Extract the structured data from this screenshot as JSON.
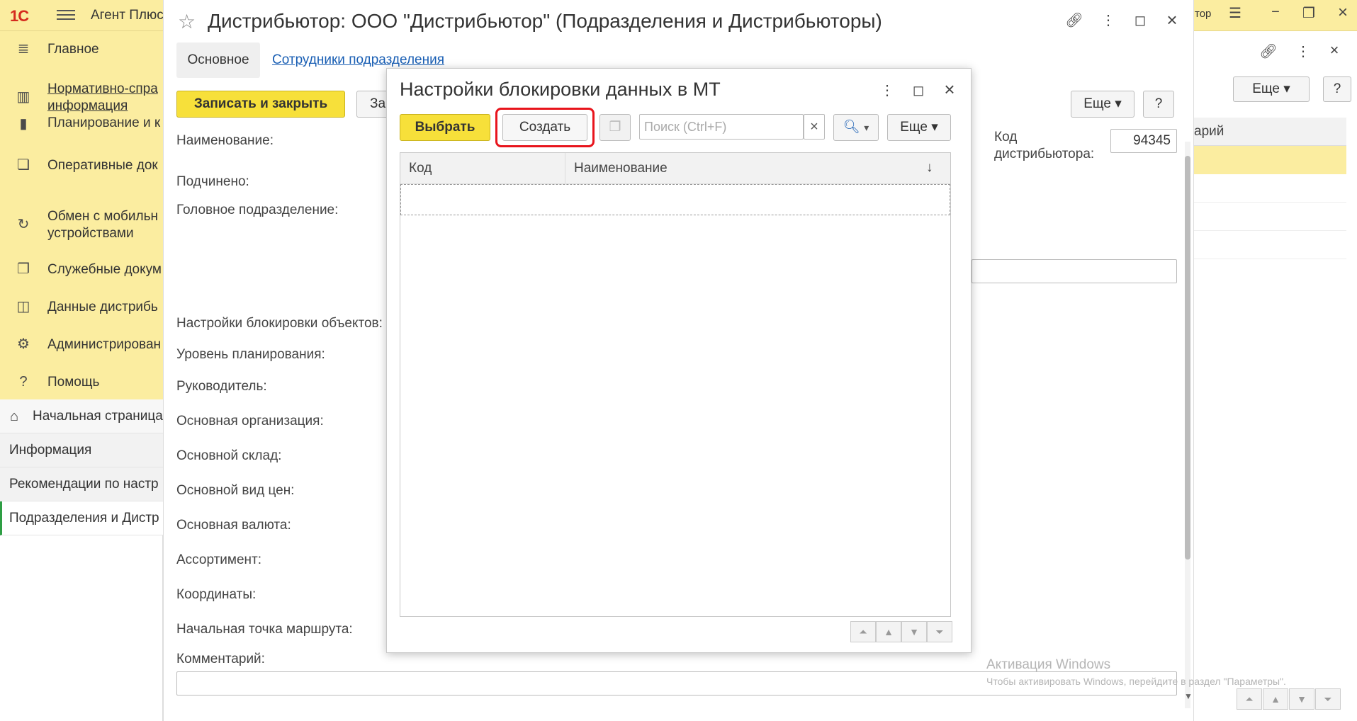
{
  "app": {
    "logo": "1С",
    "title": "Агент Плюс",
    "right_title_fragment": "тор"
  },
  "sidebar": {
    "items": [
      {
        "label": "Главное",
        "icon": "menu-lines-icon"
      },
      {
        "label": "Нормативно-справочная информация",
        "line1": "Нормативно-спра",
        "line2": "информация",
        "icon": "bar-grid-icon"
      },
      {
        "label": "Планирование и к",
        "icon": "chart-bars-icon"
      },
      {
        "label": "Оперативные док",
        "icon": "documents-icon"
      },
      {
        "label": "Обмен с мобильными устройствами",
        "line1": "Обмен с мобильн",
        "line2": "устройствами",
        "icon": "sync-icon"
      },
      {
        "label": "Служебные докум",
        "icon": "service-docs-icon"
      },
      {
        "label": "Данные дистрибь",
        "icon": "distributor-data-icon"
      },
      {
        "label": "Администрирован",
        "icon": "gear-icon"
      },
      {
        "label": "Помощь",
        "icon": "question-icon"
      }
    ],
    "open_windows": [
      {
        "label": "Начальная страница",
        "icon": "home-icon"
      },
      {
        "label": "Информация"
      },
      {
        "label": "Рекомендации по настр"
      },
      {
        "label": "Подразделения и Дистр"
      }
    ]
  },
  "form": {
    "title": "Дистрибьютор: ООО \"Дистрибьютор\" (Подразделения и Дистрибьюторы)",
    "tabs": [
      "Основное",
      "Сотрудники подразделения"
    ],
    "save_close": "Записать и закрыть",
    "write_fragment": "За",
    "more": "Еще",
    "help": "?",
    "fields": {
      "name": "Наименование:",
      "subordinate": "Подчинено:",
      "head_division": "Головное подразделение:",
      "lock_settings": "Настройки блокировки объектов:",
      "planning_level": "Уровень планирования:",
      "manager": "Руководитель:",
      "main_org": "Основная организация:",
      "main_warehouse": "Основной склад:",
      "main_price": "Основной вид цен:",
      "main_currency": "Основная валюта:",
      "assortment": "Ассортимент:",
      "coordinates": "Координаты:",
      "route_start": "Начальная точка маршрута:",
      "comment": "Комментарий:"
    },
    "distributor_code_label_1": "Код",
    "distributor_code_label_2": "дистрибьютора:",
    "distributor_code_value": "94345"
  },
  "right_panel": {
    "more": "Еще",
    "help": "?",
    "column_fragment": "арий"
  },
  "modal": {
    "title": "Настройки блокировки данных в МТ",
    "select": "Выбрать",
    "create": "Создать",
    "search_placeholder": "Поиск (Ctrl+F)",
    "search_clear": "×",
    "more": "Еще",
    "columns": [
      "Код",
      "Наименование"
    ],
    "sort_indicator": "↓"
  },
  "watermark": {
    "line1": "Активация Windows",
    "line2": "Чтобы активировать Windows, перейдите в раздел \"Параметры\"."
  },
  "colors": {
    "panel_yellow": "#fbeda0",
    "button_yellow": "#f7e03a",
    "highlight_red": "#e8141c",
    "link_blue": "#1a5fb4"
  }
}
